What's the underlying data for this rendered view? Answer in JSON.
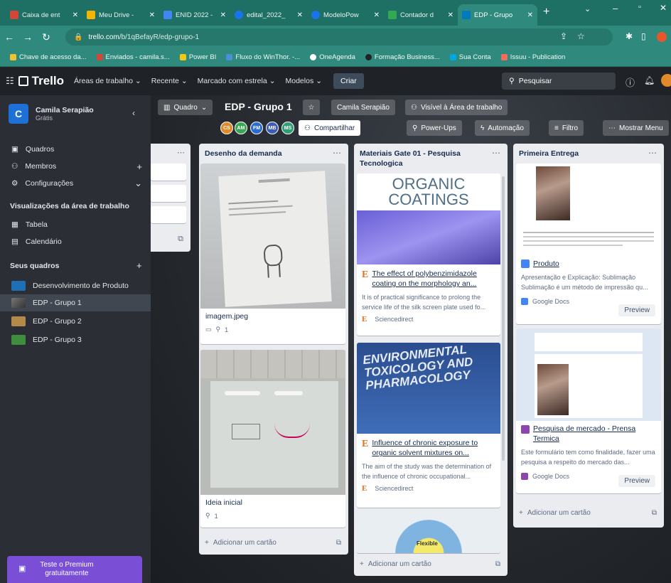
{
  "browser": {
    "tabs": [
      {
        "label": "Caixa de ent",
        "favicon_color": "#d44638"
      },
      {
        "label": "Meu Drive -",
        "favicon_color": "#f4b400"
      },
      {
        "label": "ENID 2022 -",
        "favicon_color": "#4285f4"
      },
      {
        "label": "edital_2022_",
        "favicon_color": "#1a73e8"
      },
      {
        "label": "ModeloPow",
        "favicon_color": "#1a73e8"
      },
      {
        "label": "Contador d",
        "favicon_color": "#34a853"
      },
      {
        "label": "EDP - Grupo",
        "favicon_color": "#0079bf",
        "active": true
      }
    ],
    "url_host": "trello.com",
    "url_path": "/b/1qBefayR/edp-grupo-1",
    "bookmarks": [
      {
        "label": "Chave de acesso da...",
        "color": "#f1c232"
      },
      {
        "label": "Enviados - camila.s...",
        "color": "#d44638"
      },
      {
        "label": "Power BI",
        "color": "#f2c811"
      },
      {
        "label": "Fluxo do WinThor. -...",
        "color": "#4a90d9"
      },
      {
        "label": "OneAgenda",
        "color": "#ffffff"
      },
      {
        "label": "Formação Business...",
        "color": "#222222"
      },
      {
        "label": "Sua Conta",
        "color": "#00a8e1"
      },
      {
        "label": "Issuu - Publication",
        "color": "#f36d5d"
      }
    ]
  },
  "header": {
    "logo": "Trello",
    "menus": [
      "Áreas de trabalho",
      "Recente",
      "Marcado com estrela",
      "Modelos"
    ],
    "create_label": "Criar",
    "search_placeholder": "Pesquisar"
  },
  "sidebar": {
    "workspace_initial": "C",
    "workspace_name": "Camila Serapião",
    "workspace_plan": "Grátis",
    "items": [
      {
        "label": "Quadros",
        "icon": "boards-icon"
      },
      {
        "label": "Membros",
        "icon": "members-icon",
        "plus": true
      },
      {
        "label": "Configurações",
        "icon": "settings-icon",
        "chevron": true
      }
    ],
    "views_heading": "Visualizações da área de trabalho",
    "views": [
      {
        "label": "Tabela",
        "icon": "table-icon"
      },
      {
        "label": "Calendário",
        "icon": "calendar-icon"
      }
    ],
    "boards_heading": "Seus quadros",
    "boards": [
      {
        "label": "Desenvolvimento de Produto",
        "color": "#1f6fb5"
      },
      {
        "label": "EDP - Grupo 1",
        "color": "#5a6068",
        "selected": true
      },
      {
        "label": "EDP - Grupo 2",
        "color": "#b38a4a"
      },
      {
        "label": "EDP - Grupo 3",
        "color": "#3e8e3e"
      }
    ],
    "premium_line1": "Teste o Premium",
    "premium_line2": "gratuitamente"
  },
  "board": {
    "view_label": "Quadro",
    "title": "EDP - Grupo 1",
    "workspace_button": "Camila Serapião",
    "visibility": "Visível à Área de trabalho",
    "members": [
      {
        "initials": "CS",
        "color": "#e08a2a"
      },
      {
        "initials": "AM",
        "color": "#3aa655"
      },
      {
        "initials": "FM",
        "color": "#2d6ccf"
      },
      {
        "initials": "MB",
        "color": "#3d5bb8"
      },
      {
        "initials": "MS",
        "color": "#2f9e72"
      }
    ],
    "share_label": "Compartilhar",
    "powerups_label": "Power-Ups",
    "automation_label": "Automação",
    "filter_label": "Filtro",
    "menu_label": "Mostrar Menu",
    "add_card_label": "Adicionar um cartão"
  },
  "lists": {
    "desenho": {
      "title": "Desenho da demanda",
      "card1": {
        "title": "imagem.jpeg",
        "attachments": "1"
      },
      "card2": {
        "title": "Ideia inicial",
        "attachments": "1"
      }
    },
    "gate": {
      "title": "Materiais Gate 01 - Pesquisa Tecnologica",
      "card1": {
        "cover_line1": "ORGANIC",
        "cover_line2": "COATINGS",
        "title": "The effect of polybenzimidazole coating on the morphology an...",
        "desc": "It is of practical significance to prolong the service life of the silk screen plate used fo...",
        "source": "Sciencedirect"
      },
      "card2": {
        "cover_line1": "ENVIRONMENTAL",
        "cover_line2": "TOXICOLOGY AND",
        "cover_line3": "PHARMACOLOGY",
        "title": "Influence of chronic exposure to organic solvent mixtures on...",
        "desc": "The aim of the study was the determination of the influence of chronic occupational...",
        "source": "Sciencedirect"
      },
      "card3": {
        "cover_label": "Flexible"
      }
    },
    "entrega": {
      "title": "Primeira Entrega",
      "card1": {
        "title": "Produto",
        "desc": "Apresentação e Explicação: Sublimação Sublimação é um método de impressão qu...",
        "source": "Google Docs",
        "preview": "Preview"
      },
      "card2": {
        "title": "Pesquisa de mercado - Prensa Termica",
        "desc": "Este formulário tem como finalidade, fazer uma pesquisa a respeito do mercado das...",
        "source": "Google Docs",
        "preview": "Preview"
      }
    }
  }
}
